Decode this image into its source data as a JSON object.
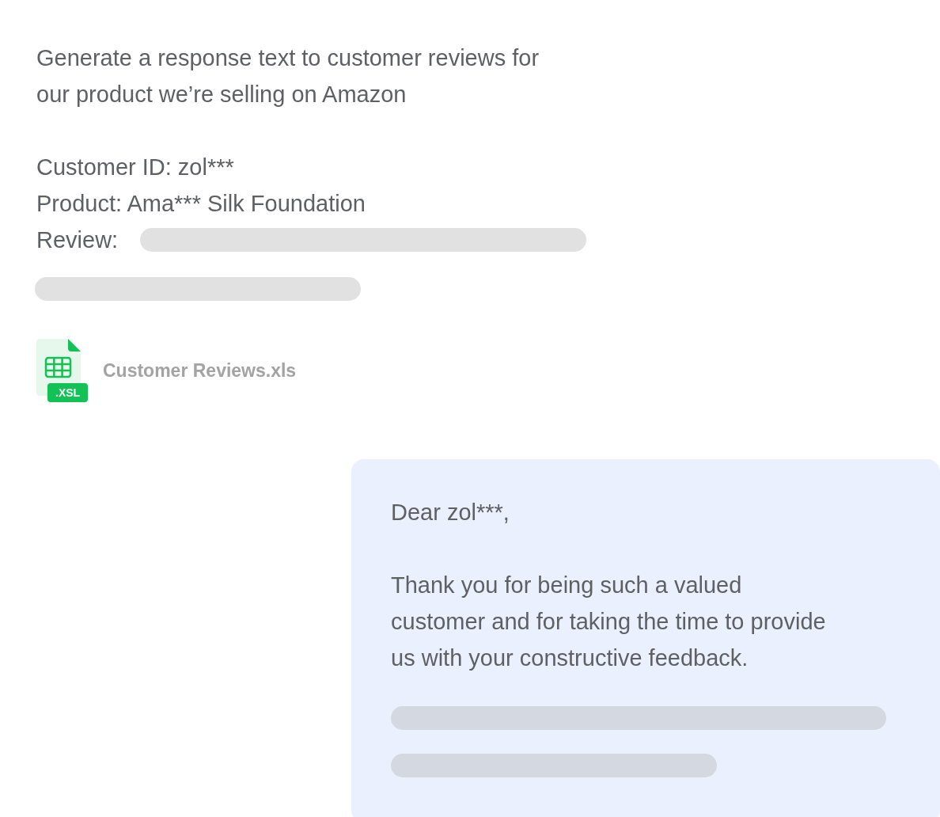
{
  "request": {
    "lines": [
      "Generate a response text to customer reviews for",
      "our product we’re selling on Amazon"
    ],
    "details": [
      "Customer ID: zol***",
      "Product: Ama*** Silk Foundation"
    ],
    "review_label": "Review:"
  },
  "attachment": {
    "name": "Customer Reviews.xls",
    "badge": ".XSL"
  },
  "reply": {
    "greeting": "Dear zol***,",
    "body_lines": [
      "Thank you for being such a valued",
      "customer and for taking the time to provide",
      "us with your constructive feedback."
    ]
  }
}
